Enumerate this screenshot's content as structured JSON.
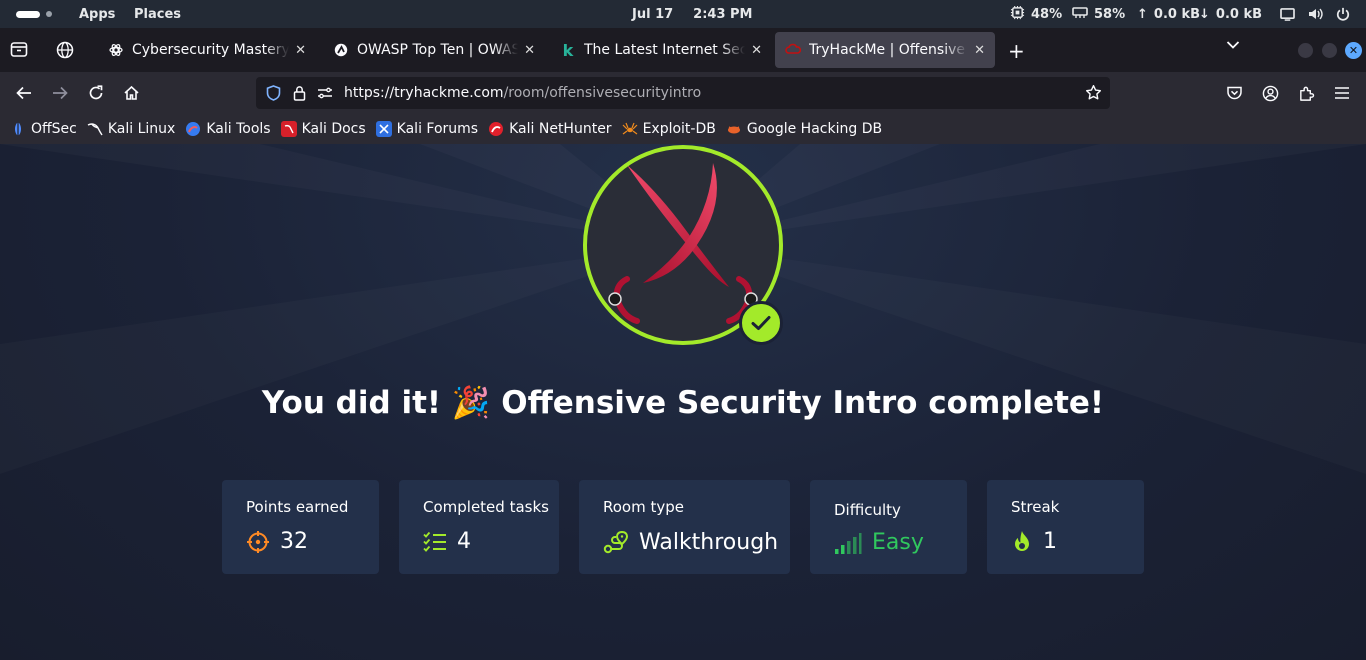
{
  "system_bar": {
    "apps": "Apps",
    "places": "Places",
    "date": "Jul 17",
    "time": "2:43 PM",
    "cpu": "48%",
    "memory": "58%",
    "upload": "0.0 kB",
    "download": "0.0 kB"
  },
  "tabs": [
    {
      "title": "Cybersecurity Mastery Plan",
      "icon": "openai-icon"
    },
    {
      "title": "OWASP Top Ten | OWASP",
      "icon": "owasp-icon"
    },
    {
      "title": "The Latest Internet Security",
      "icon": "k-icon"
    },
    {
      "title": "TryHackMe | Offensive Security",
      "icon": "tryhackme-icon",
      "active": true
    }
  ],
  "nav": {
    "url_host": "https://tryhackme.com",
    "url_path": "/room/offensivesecurityintro"
  },
  "bookmarks": [
    {
      "label": "OffSec"
    },
    {
      "label": "Kali Linux"
    },
    {
      "label": "Kali Tools"
    },
    {
      "label": "Kali Docs"
    },
    {
      "label": "Kali Forums"
    },
    {
      "label": "Kali NetHunter"
    },
    {
      "label": "Exploit-DB"
    },
    {
      "label": "Google Hacking DB"
    }
  ],
  "main": {
    "headline_start": "You did it!",
    "headline_emoji": "🎉",
    "headline_end": "Offensive Security Intro complete!",
    "stats": [
      {
        "label": "Points earned",
        "value": "32",
        "icon": "target-icon"
      },
      {
        "label": "Completed tasks",
        "value": "4",
        "icon": "checklist-icon"
      },
      {
        "label": "Room type",
        "value": "Walkthrough",
        "icon": "route-icon"
      },
      {
        "label": "Difficulty",
        "value": "Easy",
        "icon": "signal-bars-icon"
      },
      {
        "label": "Streak",
        "value": "1",
        "icon": "flame-icon"
      }
    ],
    "colors": {
      "accent": "#a3ea2a",
      "easy": "#30c85e",
      "target": "#ff8a24",
      "card": "#23304a"
    }
  }
}
